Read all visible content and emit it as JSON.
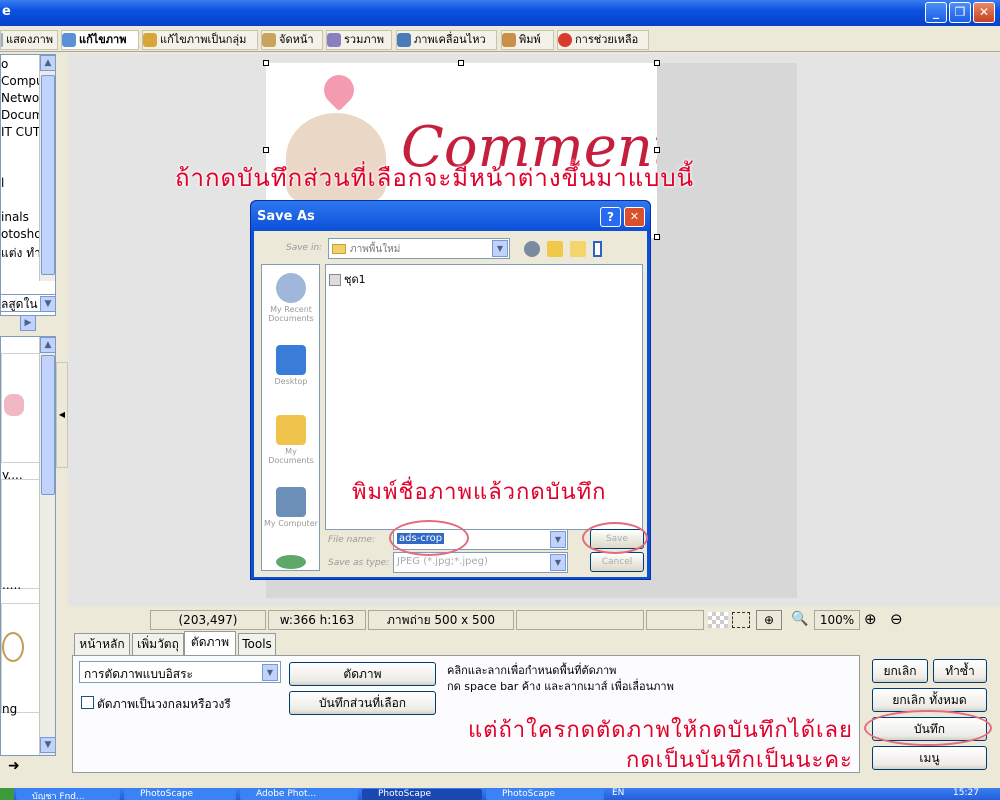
{
  "window": {
    "title": "e",
    "minimize": "_",
    "maximize": "❐",
    "close": "✕"
  },
  "tabs": [
    {
      "label": "แสดงภาพ",
      "icon": "viewer-icon"
    },
    {
      "label": "แก้ไขภาพ",
      "icon": "editor-icon",
      "active": true
    },
    {
      "label": "แก้ไขภาพเป็นกลุ่ม",
      "icon": "batch-editor-icon"
    },
    {
      "label": "จัดหน้า",
      "icon": "page-icon"
    },
    {
      "label": "รวมภาพ",
      "icon": "combine-icon"
    },
    {
      "label": "ภาพเคลื่อนไหว",
      "icon": "animated-gif-icon"
    },
    {
      "label": "พิมพ์",
      "icon": "print-icon"
    },
    {
      "label": "การช่วยเหลือ",
      "icon": "help-icon"
    }
  ],
  "left_tree": [
    "o",
    "Compu",
    "Netwo",
    "Docum",
    "IT CUT",
    "",
    "",
    "l",
    "",
    "",
    "inals",
    "otoshop",
    "แต่ง ทำ"
  ],
  "left_combo": "ลสูดใน",
  "thumb_labels": [
    "y....",
    ".....",
    "ng"
  ],
  "annotations": {
    "top": "ถ้ากดบันทึกส่วนที่เลือกจะมีหน้าต่างขึ้นมาแบบนี้",
    "middle": "พิมพ์ชื่อภาพแล้วกดบันทึก",
    "bottom_line1": "แต่ถ้าใครกดตัดภาพให้กดบันทึกได้เลย",
    "bottom_line2": "กดเป็นบันทึกเป็นนะคะ"
  },
  "dialog": {
    "title": "Save As",
    "help": "?",
    "close": "✕",
    "save_in_label": "Save in:",
    "save_in_value": "ภาพพื้นใหม่",
    "places": [
      "My Recent Documents",
      "Desktop",
      "My Documents",
      "My Computer"
    ],
    "files": [
      "ชุด1"
    ],
    "file_name_label": "File name:",
    "file_name_value": "ads-crop",
    "save_type_label": "Save as type:",
    "save_type_value": "JPEG (*.jpg;*.jpeg)",
    "save_button": "Save",
    "cancel_button": "Cancel"
  },
  "status": {
    "coords": "(203,497)",
    "selection": "w:366 h:163",
    "photo_size": "ภาพถ่าย 500 x 500",
    "zoom": "100%"
  },
  "subtabs": [
    {
      "label": "หน้าหลัก"
    },
    {
      "label": "เพิ่มวัตถุ"
    },
    {
      "label": "ตัดภาพ",
      "active": true
    },
    {
      "label": "Tools"
    }
  ],
  "crop_panel": {
    "mode_select": "การตัดภาพแบบอิสระ",
    "crop_button": "ตัดภาพ",
    "save_selection_button": "บันทึกส่วนที่เลือก",
    "oval_checkbox_label": "ตัดภาพเป็นวงกลมหรือวงรี",
    "hint_line1": "คลิกและลากเพื่อกำหนดพื้นที่ตัดภาพ",
    "hint_line2": "กด space bar ค้าง และลากเมาส์ เพื่อเลื่อนภาพ"
  },
  "right_buttons": {
    "undo": "ยกเลิก",
    "redo": "ทำซ้ำ",
    "undo_all": "ยกเลิก ทั้งหมด",
    "save": "บันทึก",
    "menu": "เมนู"
  },
  "image_text": "Comment",
  "taskbar": {
    "tasks": [
      "บัญชา Fnd...",
      "PhotoScape",
      "Adobe Phot...",
      "PhotoScape",
      "PhotoScape"
    ],
    "lang": "EN",
    "clock": "15:27"
  },
  "colors": {
    "annotation": "#e0002a",
    "xp_blue": "#0a53e0",
    "highlight_ellipse": "#e46a7d"
  }
}
